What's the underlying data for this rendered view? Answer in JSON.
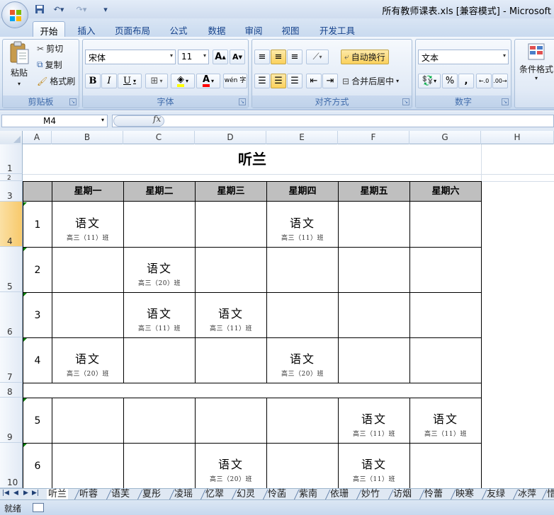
{
  "titlebar": {
    "title": "所有教师课表.xls  [兼容模式] - Microsoft"
  },
  "ribbon": {
    "tabs": [
      "开始",
      "插入",
      "页面布局",
      "公式",
      "数据",
      "审阅",
      "视图",
      "开发工具"
    ],
    "active_tab": "开始",
    "clipboard": {
      "paste": "粘贴",
      "cut": "剪切",
      "copy": "复制",
      "format_painter": "格式刷",
      "label": "剪贴板"
    },
    "font": {
      "name": "宋体",
      "size": "11",
      "label": "字体",
      "phonetic": "wén 字"
    },
    "alignment": {
      "wrap": "自动换行",
      "merge": "合并后居中",
      "label": "对齐方式"
    },
    "number": {
      "format": "文本",
      "percent": "%",
      "comma": ",",
      "label": "数字"
    },
    "styles": {
      "conditional": "条件格式"
    }
  },
  "formula_bar": {
    "name_box": "M4",
    "fx": "fx",
    "content": ""
  },
  "sheet": {
    "columns": [
      "A",
      "B",
      "C",
      "D",
      "E",
      "F",
      "G",
      "H"
    ],
    "rows": [
      "1",
      "2",
      "3",
      "4",
      "5",
      "6",
      "7",
      "8",
      "9",
      "10"
    ],
    "title": "听兰",
    "days": [
      "星期一",
      "星期二",
      "星期三",
      "星期四",
      "星期五",
      "星期六"
    ],
    "periods": [
      "1",
      "2",
      "3",
      "4",
      "5",
      "6"
    ],
    "lessons": [
      {
        "subject": "语文",
        "class": "高三（11）班"
      },
      {
        "subject": "语文",
        "class": "高三（11）班"
      },
      {
        "subject": "语文",
        "class": "高三（20）班"
      },
      {
        "subject": "语文",
        "class": "高三（11）班"
      },
      {
        "subject": "语文",
        "class": "高三（11）班"
      },
      {
        "subject": "语文",
        "class": "高三（20）班"
      },
      {
        "subject": "语文",
        "class": "高三（20）班"
      },
      {
        "subject": "语文",
        "class": "高三（11）班"
      },
      {
        "subject": "语文",
        "class": "高三（11）班"
      },
      {
        "subject": "语文",
        "class": "高三（20）班"
      },
      {
        "subject": "语文",
        "class": "高三（11）班"
      }
    ]
  },
  "sheet_tabs": [
    "听兰",
    "听蓉",
    "语芙",
    "夏彤",
    "凌瑶",
    "忆翠",
    "幻灵",
    "怜菡",
    "紫南",
    "依珊",
    "妙竹",
    "访烟",
    "怜蕾",
    "映寒",
    "友绿",
    "冰萍",
    "惜"
  ],
  "status": {
    "text": "就绪"
  },
  "colors": {
    "header_fill": "#bfbfbf",
    "selection": "#f7c96b",
    "accent": "#15428b"
  }
}
